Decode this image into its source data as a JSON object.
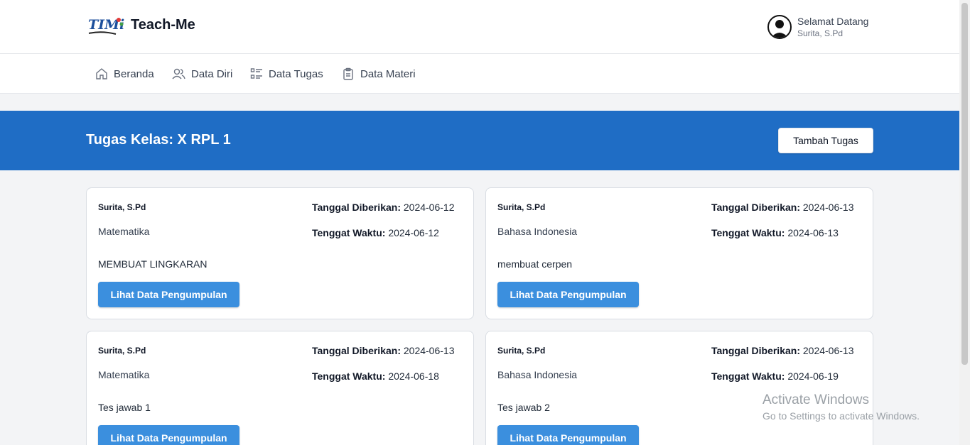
{
  "app": {
    "name": "Teach-Me",
    "logo_text": "TIMi"
  },
  "user": {
    "welcome": "Selamat Datang",
    "name": "Surita, S.Pd"
  },
  "nav": {
    "home": "Beranda",
    "profile": "Data Diri",
    "tasks": "Data Tugas",
    "materials": "Data Materi"
  },
  "banner": {
    "title": "Tugas Kelas: X RPL 1",
    "add_button": "Tambah Tugas"
  },
  "labels": {
    "given": "Tanggal Diberikan:",
    "due": "Tenggat Waktu:",
    "action_button": "Lihat Data Pengumpulan"
  },
  "tasks": [
    {
      "teacher": "Surita, S.Pd",
      "subject": "Matematika",
      "description": "MEMBUAT LINGKARAN",
      "given": "2024-06-12",
      "due": "2024-06-12"
    },
    {
      "teacher": "Surita, S.Pd",
      "subject": "Bahasa Indonesia",
      "description": "membuat cerpen",
      "given": "2024-06-13",
      "due": "2024-06-13"
    },
    {
      "teacher": "Surita, S.Pd",
      "subject": "Matematika",
      "description": "Tes jawab 1",
      "given": "2024-06-13",
      "due": "2024-06-18"
    },
    {
      "teacher": "Surita, S.Pd",
      "subject": "Bahasa Indonesia",
      "description": "Tes jawab 2",
      "given": "2024-06-13",
      "due": "2024-06-19"
    }
  ],
  "watermark": {
    "title": "Activate Windows",
    "subtitle": "Go to Settings to activate Windows."
  },
  "colors": {
    "banner": "#1f6dc5",
    "button": "#3b8fde"
  }
}
